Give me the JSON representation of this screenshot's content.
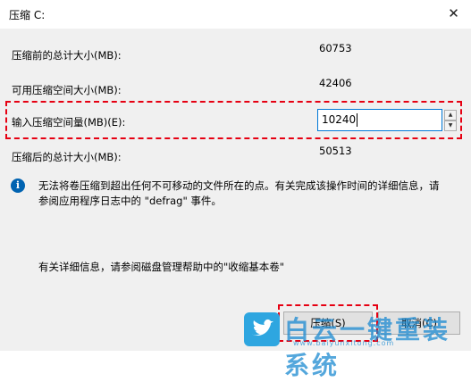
{
  "window": {
    "title": "压缩 C:",
    "close_glyph": "✕"
  },
  "fields": {
    "total_before_label": "压缩前的总计大小(MB):",
    "total_before_value": "60753",
    "available_label": "可用压缩空间大小(MB):",
    "available_value": "42406",
    "shrink_amount_label": "输入压缩空间量(MB)(E):",
    "shrink_amount_value": "10240",
    "total_after_label": "压缩后的总计大小(MB):",
    "total_after_value": "50513"
  },
  "info": {
    "icon": "info-icon",
    "line1": "无法将卷压缩到超出任何不可移动的文件所在的点。有关完成该操作时间的详细信息，请",
    "line2": "参阅应用程序日志中的 \"defrag\" 事件。"
  },
  "note": "有关详细信息，请参阅磁盘管理帮助中的\"收缩基本卷\"",
  "buttons": {
    "shrink_label": "压缩(S)",
    "cancel_label": "取消(C)"
  },
  "watermark": {
    "text": "白云一键重装系统",
    "url": "www.baiyunxitong.com"
  },
  "colors": {
    "highlight": "#e60012",
    "focus_border": "#0078d7",
    "info_icon": "#0063b1"
  }
}
